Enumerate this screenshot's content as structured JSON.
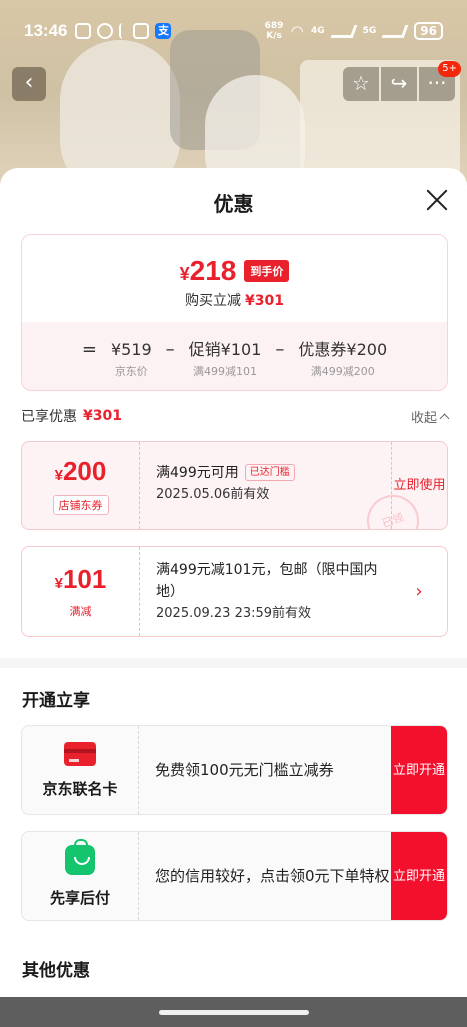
{
  "status_bar": {
    "time": "13:46",
    "net_speed_value": "689",
    "net_speed_unit": "K/s",
    "signal1": "4G",
    "signal2": "5G",
    "battery": "96"
  },
  "nav": {
    "back_icon": "chevron-left-icon",
    "message_badge": "5+"
  },
  "sheet": {
    "title": "优惠"
  },
  "price_card": {
    "final_price_symbol": "¥",
    "final_price": "218",
    "final_tag": "到手价",
    "buy_reduce_label": "购买立减",
    "buy_reduce_value": "¥301",
    "formula": {
      "equals": "=",
      "minus": "–",
      "jd_price": "¥519",
      "jd_price_label": "京东价",
      "promo": "促销¥101",
      "promo_label": "满499减101",
      "coupon": "优惠券¥200",
      "coupon_label": "满499减200"
    }
  },
  "enjoyed": {
    "label": "已享优惠",
    "value": "¥301",
    "collapse": "收起"
  },
  "coupons": [
    {
      "symbol": "¥",
      "amount": "200",
      "label": "店铺东券",
      "condition": "满499元可用",
      "tag": "已达门槛",
      "date": "2025.05.06前有效",
      "action": "立即使用",
      "stamp": "已领"
    },
    {
      "symbol": "¥",
      "amount": "101",
      "label": "满减",
      "condition": "满499元减101元，包邮（限中国内地）",
      "date": "2025.09.23 23:59前有效",
      "action": "›"
    }
  ],
  "open_section": {
    "title": "开通立享",
    "services": [
      {
        "icon": "credit-card-icon",
        "name": "京东联名卡",
        "desc": "免费领100元无门槛立减券",
        "action": "立即开通"
      },
      {
        "icon": "shopping-bag-icon",
        "name": "先享后付",
        "desc": "您的信用较好，点击领0元下单特权",
        "action": "立即开通"
      }
    ]
  },
  "other_section": {
    "title": "其他优惠"
  }
}
